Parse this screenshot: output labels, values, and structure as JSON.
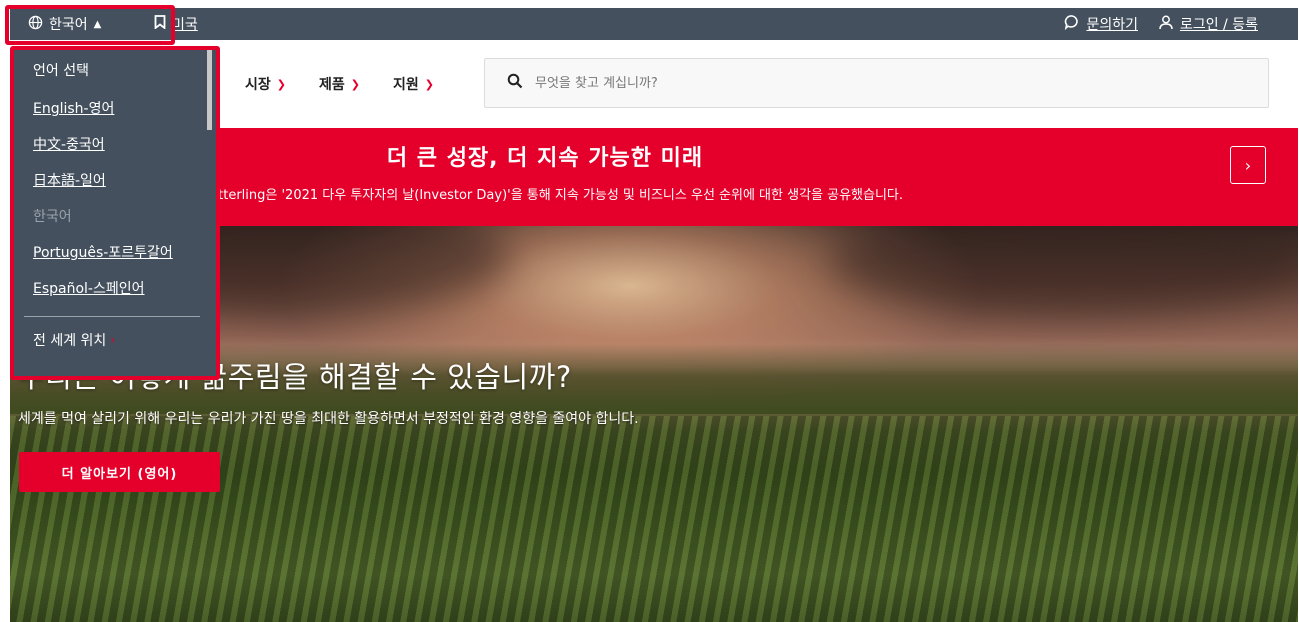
{
  "topbar": {
    "language_label": "한국어",
    "country_label": "미국",
    "contact_label": "문의하기",
    "login_label": "로그인 / 등록"
  },
  "language_menu": {
    "heading": "언어 선택",
    "options": [
      {
        "label": "English-영어"
      },
      {
        "label": "中文-중국어"
      },
      {
        "label": "日本語-일어"
      },
      {
        "label": "한국어"
      },
      {
        "label": "Português-포르투갈어"
      },
      {
        "label": "Español-스페인어"
      }
    ],
    "worldwide_label": "전 세계 위치"
  },
  "nav": {
    "items": [
      {
        "label": "시장"
      },
      {
        "label": "제품"
      },
      {
        "label": "지원"
      }
    ],
    "search_placeholder": "무엇을 찾고 계십니까?"
  },
  "banner": {
    "title": "더 큰 성장, 더 지속 가능한 미래",
    "subtitle": "Fitterling은 '2021 다우 투자자의 날(Investor Day)'을 통해 지속 가능성 및 비즈니스 우선 순위에 대한 생각을 공유했습니다."
  },
  "hero": {
    "title": "우리는 어떻게 굶주림을 해결할 수 있습니까?",
    "description": "세계를 먹여 살리기 위해 우리는 우리가 가진 땅을 최대한 활용하면서 부정적인 환경 영향을 줄여야 합니다.",
    "cta_label": "더 알아보기 (영어)"
  },
  "colors": {
    "brand_red": "#e4002b",
    "topbar_bg": "#44505e"
  }
}
